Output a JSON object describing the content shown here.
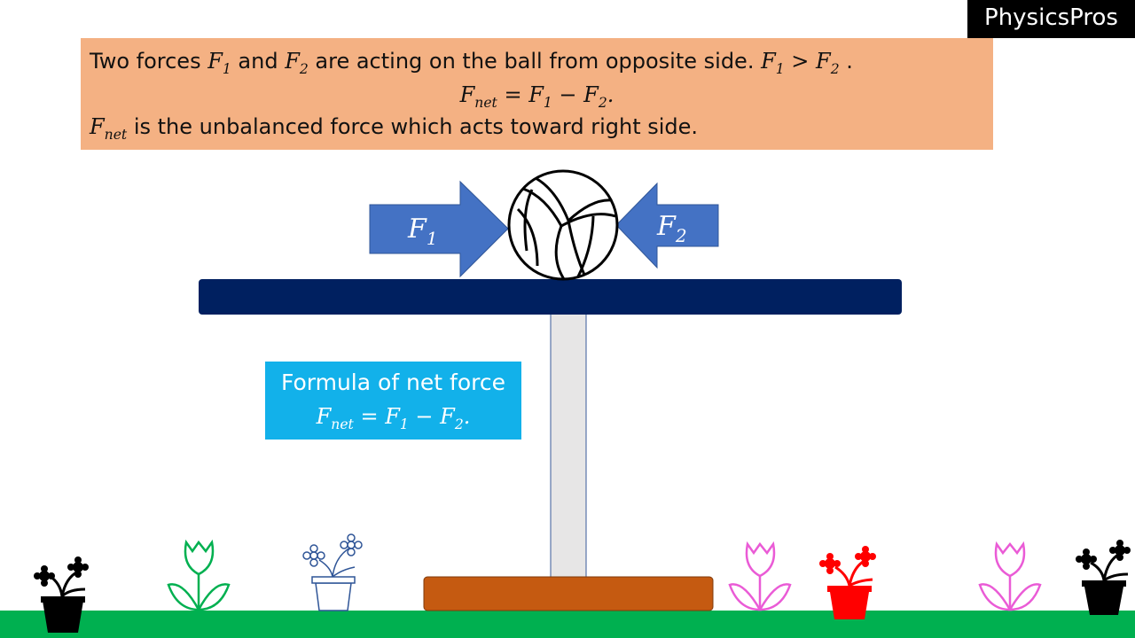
{
  "brand": "PhysicsPros",
  "note": {
    "line1": {
      "pre": "Two forces ",
      "f1": "F",
      "f1_sub": "1",
      "and": " and ",
      "f2": "F",
      "f2_sub": "2",
      "post": " are acting on the ball from opposite side. ",
      "c1": "F",
      "c1_sub": "1",
      "gt": " > ",
      "c2": "F",
      "c2_sub": "2",
      "end": " ."
    },
    "line2": {
      "net": "F",
      "net_sub": "net",
      "eq": " =  ",
      "a": "F",
      "a_sub": "1",
      "minus": " − ",
      "b": "F",
      "b_sub": "2",
      "end": "."
    },
    "line3": {
      "net": "F",
      "net_sub": "net",
      "text": " is the unbalanced force which acts toward right side."
    }
  },
  "arrows": {
    "left": {
      "label": "F",
      "sub": "1",
      "color": "#4472c4"
    },
    "right": {
      "label": "F",
      "sub": "2",
      "color": "#4472c4"
    }
  },
  "formula_box": {
    "title": "Formula of net force",
    "net": "F",
    "net_sub": "net",
    "eq": " =  ",
    "a": "F",
    "a_sub": "1",
    "minus": " − ",
    "b": "F",
    "b_sub": "2",
    "end": "."
  },
  "colors": {
    "note_bg": "#f4b183",
    "formula_bg": "#12b1ea",
    "tabletop": "#002060",
    "stand": "#e7e6e6",
    "base": "#c55a11",
    "ground": "#00b050"
  },
  "icons": [
    "volleyball-icon",
    "black-potted-flower-icon",
    "green-tulip-icon",
    "blue-outline-potted-flower-icon",
    "pink-tulip-icon",
    "red-potted-flower-icon"
  ]
}
